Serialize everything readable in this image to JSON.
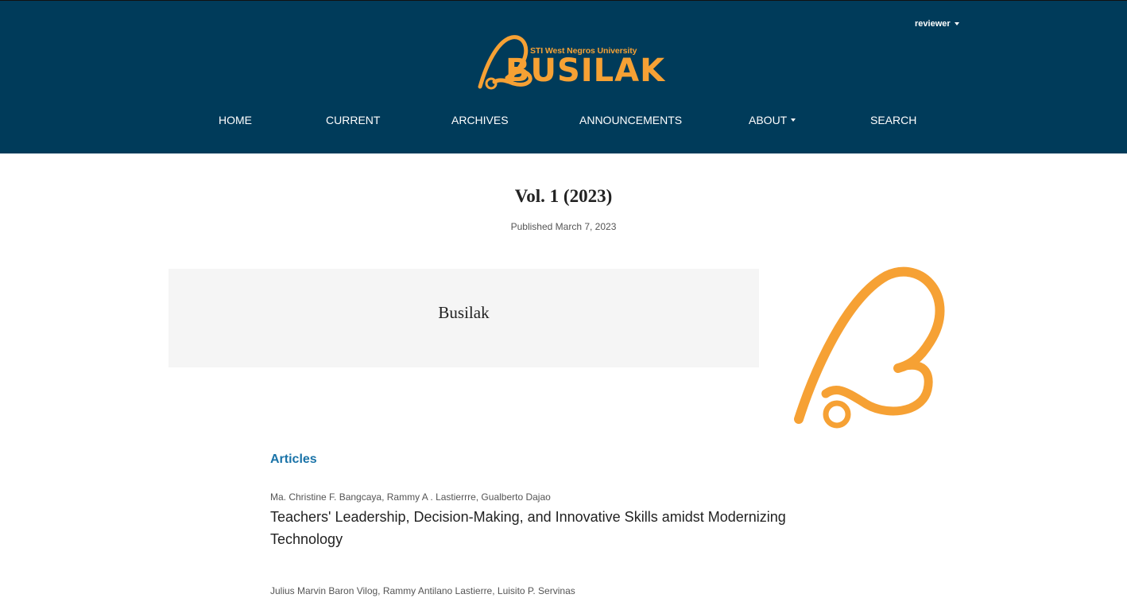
{
  "header": {
    "user_menu_label": "reviewer",
    "logo": {
      "subtitle": "STI West Negros University",
      "name": "BUSILAK"
    },
    "nav": [
      {
        "label": "HOME"
      },
      {
        "label": "CURRENT"
      },
      {
        "label": "ARCHIVES"
      },
      {
        "label": "ANNOUNCEMENTS"
      },
      {
        "label": "ABOUT"
      },
      {
        "label": "SEARCH"
      }
    ]
  },
  "issue": {
    "title": "Vol. 1 (2023)",
    "published": "Published March 7, 2023",
    "description": "Busilak"
  },
  "articles": {
    "section_title": "Articles",
    "items": [
      {
        "authors": "Ma. Christine F. Bangcaya, Rammy A . Lastierrre, Gualberto Dajao",
        "title_line1": "Teachers' Leadership, Decision-Making, and Innovative Skills amidst Modernizing",
        "title_line2": "Technology"
      },
      {
        "authors": "Julius Marvin Baron Vilog, Rammy Antilano Lastierre, Luisito P. Servinas"
      }
    ]
  },
  "colors": {
    "header_bg": "#003b5a",
    "brand_orange": "#f6a134",
    "link_blue": "#1a73a8"
  }
}
